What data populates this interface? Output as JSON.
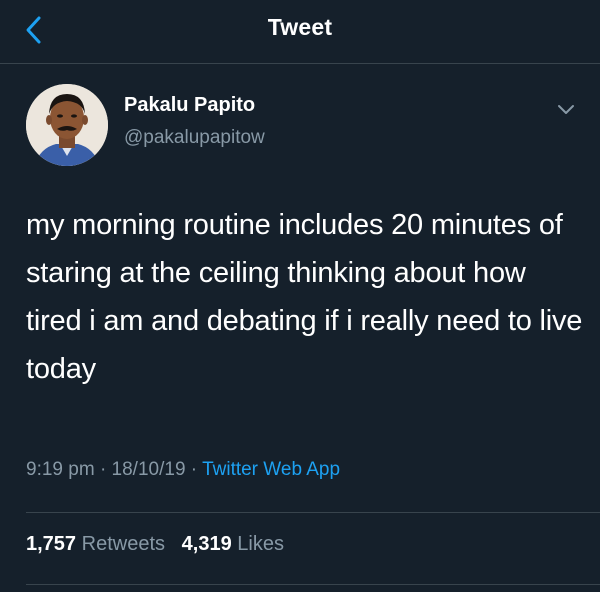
{
  "header": {
    "title": "Tweet",
    "back_icon": "chevron-left-icon"
  },
  "colors": {
    "background": "#15202b",
    "accent": "#1da1f2",
    "secondary_text": "#8899a6",
    "divider": "#38444d"
  },
  "author": {
    "display_name": "Pakalu Papito",
    "handle": "@pakalupapitow"
  },
  "tweet": {
    "text": "my morning routine includes 20 minutes of staring at the ceiling thinking about how tired i am and debating if i really need to live today",
    "time": "9:19 pm",
    "date": "18/10/19",
    "separator": "·",
    "source": "Twitter Web App"
  },
  "stats": {
    "retweets_count": "1,757",
    "retweets_label": "Retweets",
    "likes_count": "4,319",
    "likes_label": "Likes"
  }
}
